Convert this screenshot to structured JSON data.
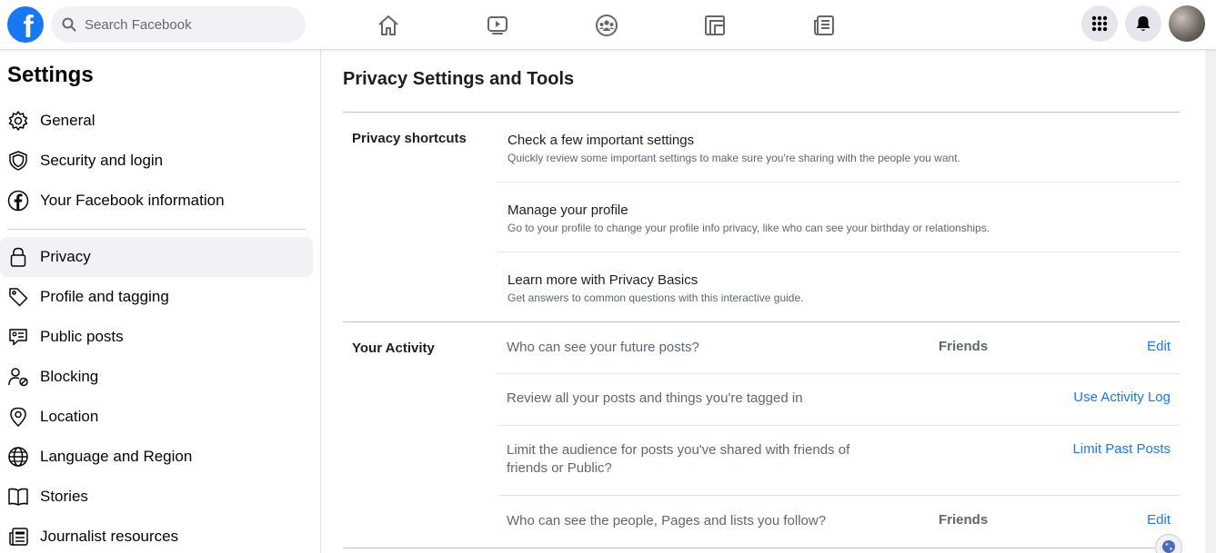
{
  "topbar": {
    "logo_letter": "f",
    "search_placeholder": "Search Facebook",
    "nav_icons": [
      "home-icon",
      "watch-icon",
      "groups-icon",
      "gaming-icon",
      "news-icon"
    ],
    "right_icons": [
      "menu-grid-icon",
      "notifications-icon"
    ],
    "brand_color": "#1877f2"
  },
  "sidebar": {
    "title": "Settings",
    "items": [
      {
        "label": "General",
        "icon": "gear-icon"
      },
      {
        "label": "Security and login",
        "icon": "shield-icon"
      },
      {
        "label": "Your Facebook information",
        "icon": "facebook-icon"
      },
      {
        "label": "Privacy",
        "icon": "lock-icon",
        "active": true
      },
      {
        "label": "Profile and tagging",
        "icon": "tag-icon"
      },
      {
        "label": "Public posts",
        "icon": "public-posts-icon"
      },
      {
        "label": "Blocking",
        "icon": "blocking-icon"
      },
      {
        "label": "Location",
        "icon": "location-icon"
      },
      {
        "label": "Language and Region",
        "icon": "globe-icon"
      },
      {
        "label": "Stories",
        "icon": "book-icon"
      },
      {
        "label": "Journalist resources",
        "icon": "newspaper-icon"
      }
    ]
  },
  "main": {
    "title": "Privacy Settings and Tools",
    "shortcuts": {
      "section_label": "Privacy shortcuts",
      "items": [
        {
          "title": "Check a few important settings",
          "subtitle": "Quickly review some important settings to make sure you're sharing with the people you want."
        },
        {
          "title": "Manage your profile",
          "subtitle": "Go to your profile to change your profile info privacy, like who can see your birthday or relationships."
        },
        {
          "title": "Learn more with Privacy Basics",
          "subtitle": "Get answers to common questions with this interactive guide."
        }
      ]
    },
    "activity": {
      "section_label": "Your Activity",
      "rows": [
        {
          "question": "Who can see your future posts?",
          "value": "Friends",
          "action": "Edit"
        },
        {
          "question": "Review all your posts and things you're tagged in",
          "value": "",
          "action": "Use Activity Log"
        },
        {
          "question_line1": "Limit the audience for posts you've shared with friends of",
          "question_line2": "friends or Public?",
          "value": "",
          "action": "Limit Past Posts"
        },
        {
          "question": "Who can see the people, Pages and lists you follow?",
          "value": "Friends",
          "action": "Edit"
        }
      ]
    }
  }
}
